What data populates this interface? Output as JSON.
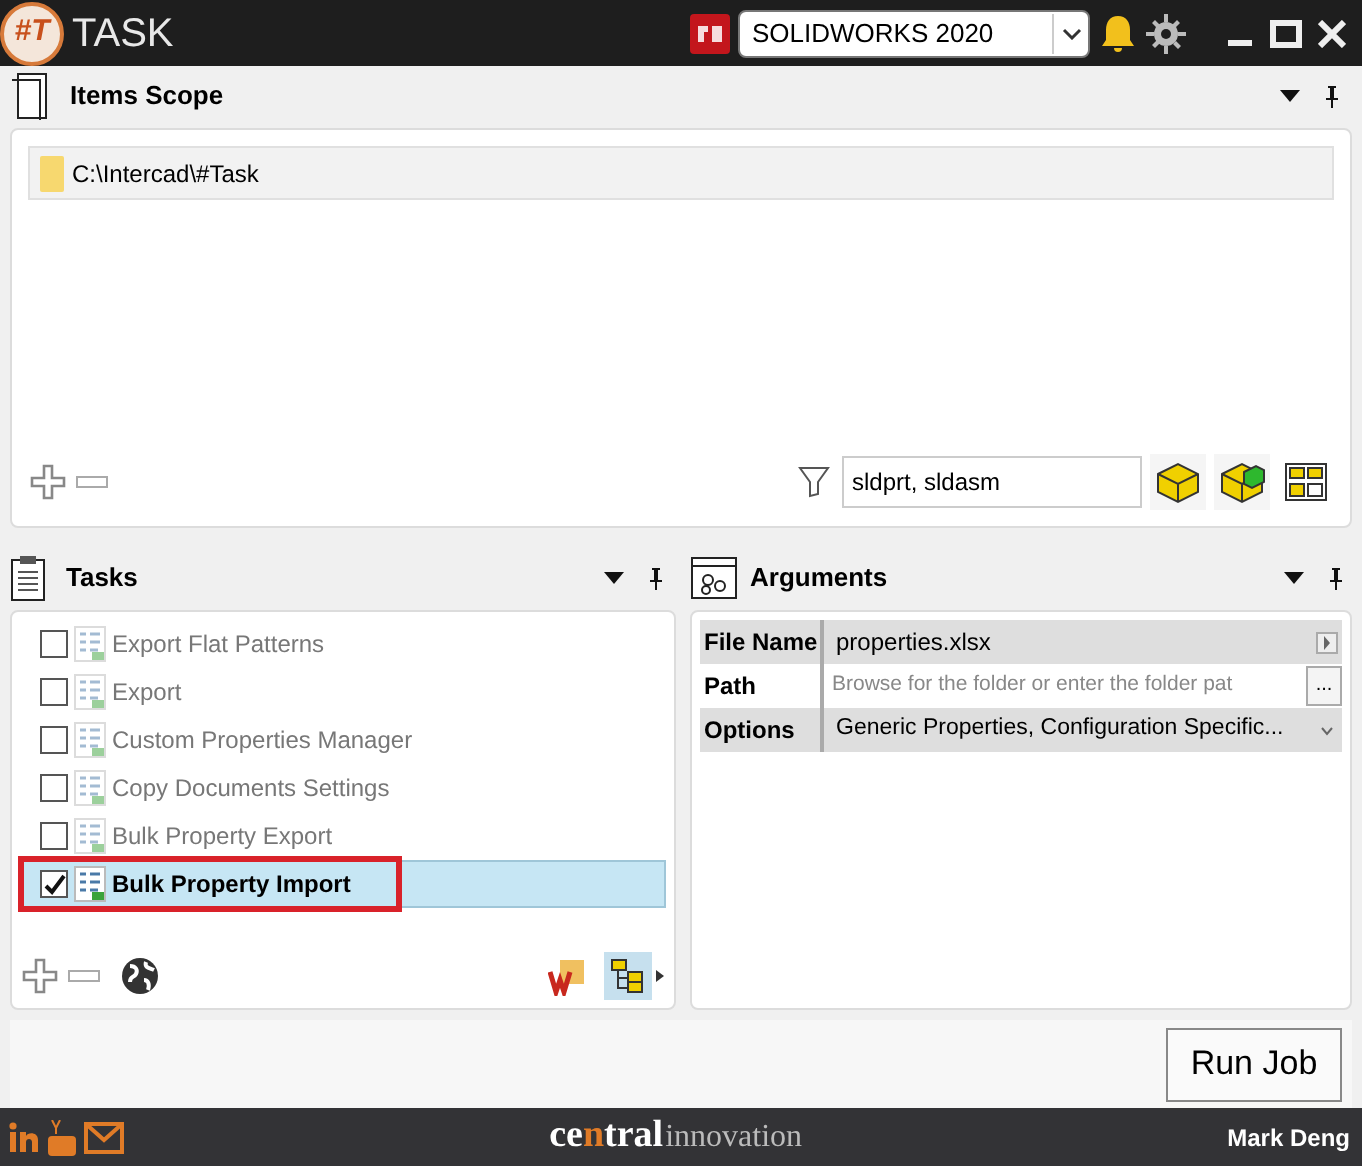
{
  "title_bar": {
    "logo": "#T",
    "title": "TASK",
    "version": "SOLIDWORKS 2020"
  },
  "items_scope": {
    "title": "Items Scope",
    "items": [
      {
        "path": "C:\\Intercad\\#Task",
        "selected": true
      }
    ],
    "filter": "sldprt, sldasm"
  },
  "tasks": {
    "title": "Tasks",
    "items": [
      {
        "label": "Export Flat Patterns",
        "checked": false,
        "selected": false
      },
      {
        "label": "Export",
        "checked": false,
        "selected": false
      },
      {
        "label": "Custom Properties Manager",
        "checked": false,
        "selected": false
      },
      {
        "label": "Copy Documents Settings",
        "checked": false,
        "selected": false
      },
      {
        "label": "Bulk Property Export",
        "checked": false,
        "selected": false
      },
      {
        "label": "Bulk Property Import",
        "checked": true,
        "selected": true
      }
    ]
  },
  "arguments": {
    "title": "Arguments",
    "rows": [
      {
        "label": "File Name",
        "value": "properties.xlsx",
        "kind": "text"
      },
      {
        "label": "Path",
        "placeholder": "Browse for the folder or enter the folder pat",
        "kind": "browse",
        "browse": "..."
      },
      {
        "label": "Options",
        "value": "Generic Properties, Configuration Specific...",
        "kind": "dropdown"
      }
    ]
  },
  "run_button": "Run Job",
  "footer": {
    "logo_parts": [
      {
        "text": "ce",
        "accent": false
      },
      {
        "text": "n",
        "accent": true
      },
      {
        "text": "tral",
        "accent": false
      }
    ],
    "logo_light": "innovation",
    "user": "Mark Deng"
  }
}
